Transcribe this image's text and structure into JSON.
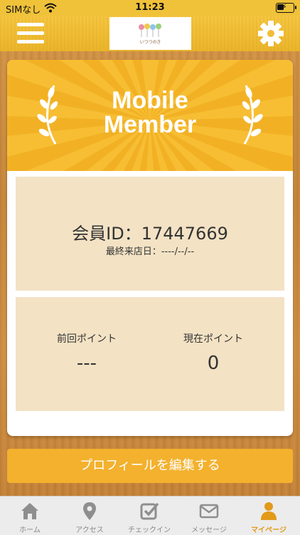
{
  "status_bar": {
    "carrier": "SIMなし",
    "time": "11:23"
  },
  "header": {
    "logo_text": "いつつのき"
  },
  "member_card": {
    "title_line1": "Mobile",
    "title_line2": "Member",
    "member_id": "会員ID：17447669",
    "last_visit": "最終来店日：----/--/--",
    "previous_points_label": "前回ポイント",
    "previous_points_value": "---",
    "current_points_label": "現在ポイント",
    "current_points_value": "0"
  },
  "edit_profile_label": "プロフィールを編集する",
  "tabs": [
    {
      "label": "ホーム",
      "icon": "home-icon"
    },
    {
      "label": "アクセス",
      "icon": "map-pin-icon"
    },
    {
      "label": "チェックイン",
      "icon": "checkin-icon"
    },
    {
      "label": "メッセージ",
      "icon": "mail-icon"
    },
    {
      "label": "マイページ",
      "icon": "user-icon"
    }
  ],
  "colors": {
    "accent": "#f3b12e",
    "active_tab": "#e29a1a",
    "panel": "#f3e2c4"
  }
}
